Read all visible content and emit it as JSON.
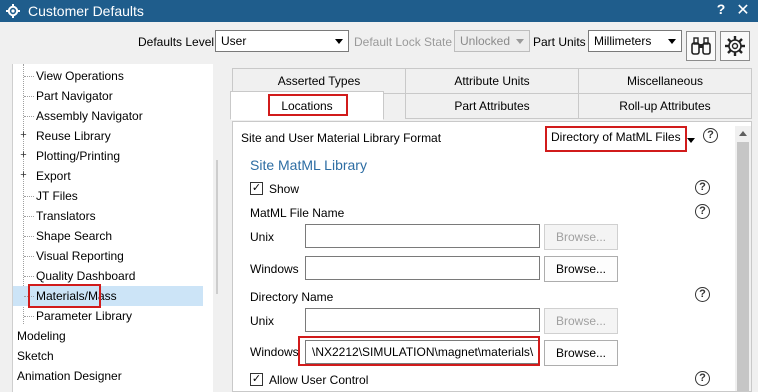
{
  "window": {
    "title": "Customer Defaults",
    "help": "?",
    "close": "✕"
  },
  "toolbar": {
    "defaults_level_label": "Defaults Level",
    "defaults_level_value": "User",
    "lock_state_label": "Default Lock State",
    "lock_state_value": "Unlocked",
    "part_units_label": "Part Units",
    "part_units_value": "Millimeters"
  },
  "tree": {
    "items": [
      {
        "label": "View Operations"
      },
      {
        "label": "Part Navigator"
      },
      {
        "label": "Assembly Navigator"
      },
      {
        "label": "Reuse Library",
        "expander": "+"
      },
      {
        "label": "Plotting/Printing",
        "expander": "+"
      },
      {
        "label": "Export",
        "expander": "+"
      },
      {
        "label": "JT Files"
      },
      {
        "label": "Translators"
      },
      {
        "label": "Shape Search"
      },
      {
        "label": "Visual Reporting"
      },
      {
        "label": "Quality Dashboard"
      },
      {
        "label": "Materials/Mass"
      },
      {
        "label": "Parameter Library"
      },
      {
        "label": "Modeling"
      },
      {
        "label": "Sketch"
      },
      {
        "label": "Animation Designer"
      }
    ]
  },
  "tabs": {
    "row1": [
      "Asserted Types",
      "Attribute Units",
      "Miscellaneous"
    ],
    "row2": [
      "Locations",
      "Part Attributes",
      "Roll-up Attributes"
    ]
  },
  "content": {
    "format_label": "Site and User Material Library Format",
    "format_value": "Directory of MatML Files",
    "site_section": "Site MatML Library",
    "show_label": "Show",
    "matml_file_name_label": "MatML File Name",
    "unix_label": "Unix",
    "windows_label": "Windows",
    "unix_file_value": "",
    "windows_file_value": "",
    "directory_name_label": "Directory Name",
    "unix_dir_value": "",
    "windows_dir_value": "\\NX2212\\SIMULATION\\magnet\\materials\\",
    "browse_label": "Browse...",
    "allow_user_control_label": "Allow User Control",
    "help_symbol": "?",
    "check_mark": "✓"
  }
}
